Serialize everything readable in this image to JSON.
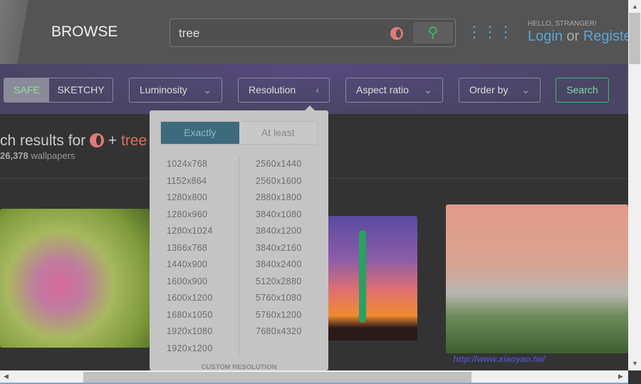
{
  "header": {
    "title": "BROWSE",
    "search_value": "tree",
    "greeting": "HELLO, STRANGER!",
    "login": "Login",
    "or": " or ",
    "register": "Register"
  },
  "filters": {
    "safe": "SAFE",
    "sketchy": "SKETCHY",
    "luminosity": "Luminosity",
    "resolution": "Resolution",
    "aspect_ratio": "Aspect ratio",
    "order_by": "Order by",
    "search": "Search"
  },
  "results": {
    "prefix": "ch results for ",
    "plus": " + ",
    "term": "tree",
    "count": "26,378",
    "count_suffix": " wallpapers"
  },
  "resolution_dropdown": {
    "mode_exactly": "Exactly",
    "mode_at_least": "At least",
    "selected_mode": "Exactly",
    "left": [
      "1024x768",
      "1152x864",
      "1280x800",
      "1280x960",
      "1280x1024",
      "1366x768",
      "1440x900",
      "1600x900",
      "1600x1200",
      "1680x1050",
      "1920x1080",
      "1920x1200"
    ],
    "right": [
      "2560x1440",
      "2560x1600",
      "2880x1800",
      "3840x1080",
      "3840x1200",
      "3840x2160",
      "3840x2400",
      "5120x2880",
      "5760x1080",
      "5760x1200",
      "7680x4320"
    ],
    "custom_label": "CUSTOM RESOLUTION"
  },
  "watermark": "http://www.xiaoyao.tw/",
  "colors": {
    "accent_green": "#3fb86c",
    "link_blue": "#5aa6d6",
    "filter_bar": "#4a4565",
    "exactly_active": "#3e6a7e",
    "term_red": "#e07060"
  }
}
